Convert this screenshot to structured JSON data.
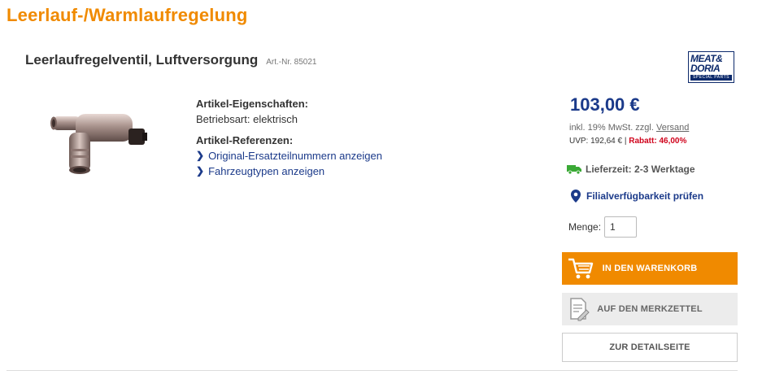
{
  "page": {
    "title": "Leerlauf-/Warmlaufregelung"
  },
  "product": {
    "name": "Leerlaufregelventil, Luftversorgung",
    "art_nr": "Art.-Nr. 85021",
    "brand": {
      "line1": "MEAT&",
      "line2": "DORIA",
      "line3": "SPECIAL PARTS",
      "color": "#0d2a6b"
    },
    "properties_heading": "Artikel-Eigenschaften:",
    "properties": [
      {
        "text": "Betriebsart: elektrisch"
      }
    ],
    "references_heading": "Artikel-Referenzen:",
    "references": [
      {
        "label": "Original-Ersatzteilnummern anzeigen",
        "icon": "chevron-right-icon"
      },
      {
        "label": "Fahrzeugtypen anzeigen",
        "icon": "chevron-right-icon"
      }
    ]
  },
  "pricing": {
    "price": "103,00 €",
    "tax_prefix": "inkl. 19% MwSt. zzgl.",
    "tax_link": "Versand",
    "uvp": "UVP: 192,64 €",
    "separator": "|",
    "discount": "Rabatt: 46,00%",
    "price_color": "#1b3a8a",
    "discount_color": "#d0021b"
  },
  "availability": {
    "delivery_label": "Lieferzeit:",
    "delivery_value": "2-3 Werktage",
    "branch_link": "Filialverfügbarkeit prüfen",
    "truck_color": "#3aa935"
  },
  "quantity": {
    "label": "Menge:",
    "value": "1"
  },
  "actions": {
    "cart": "IN DEN WARENKORB",
    "wishlist": "AUF DEN MERKZETTEL",
    "detail": "ZUR DETAILSEITE",
    "accent": "#f08a00"
  }
}
